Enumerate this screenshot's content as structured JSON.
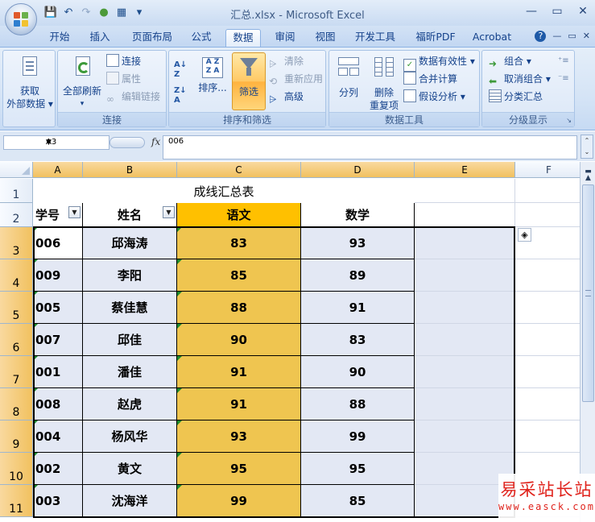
{
  "window": {
    "title": "汇总.xlsx - Microsoft Excel",
    "controls": [
      "—",
      "▭",
      "✕"
    ]
  },
  "tabs": [
    "开始",
    "插入",
    "页面布局",
    "公式",
    "数据",
    "审阅",
    "视图",
    "开发工具",
    "福昕PDF",
    "Acrobat"
  ],
  "active_tab": "数据",
  "tab_right": [
    "?",
    "—",
    "▭",
    "✕"
  ],
  "ribbon": {
    "groups": {
      "connections": "连接",
      "sort_filter": "排序和筛选",
      "data_tools": "数据工具",
      "outline": "分级显示"
    },
    "get_external_1": "获取",
    "get_external_2": "外部数据",
    "refresh_all": "全部刷新",
    "connections": "连接",
    "properties": "属性",
    "edit_links": "编辑链接",
    "sort": "排序...",
    "filter": "筛选",
    "clear": "清除",
    "reapply": "重新应用",
    "advanced": "高级",
    "text_to_columns": "分列",
    "remove_duplicates_1": "删除",
    "remove_duplicates_2": "重复项",
    "data_validation": "数据有效性",
    "consolidate": "合并计算",
    "what_if": "假设分析",
    "group": "组合",
    "ungroup": "取消组合",
    "subtotal": "分类汇总"
  },
  "formula_bar": {
    "name_box": "A3",
    "fx": "fx",
    "value": "006"
  },
  "sheet": {
    "columns": [
      "A",
      "B",
      "C",
      "D",
      "E",
      "F"
    ],
    "rows": [
      "1",
      "2",
      "3",
      "4",
      "5",
      "6",
      "7",
      "8",
      "9",
      "10",
      "11"
    ],
    "title": "成线汇总表",
    "headers": [
      "学号",
      "姓名",
      "语文",
      "数学"
    ],
    "data": [
      [
        "006",
        "邱海涛",
        "83",
        "93"
      ],
      [
        "009",
        "李阳",
        "85",
        "89"
      ],
      [
        "005",
        "蔡佳慧",
        "88",
        "91"
      ],
      [
        "007",
        "邱佳",
        "90",
        "83"
      ],
      [
        "001",
        "潘佳",
        "91",
        "90"
      ],
      [
        "008",
        "赵虎",
        "91",
        "88"
      ],
      [
        "004",
        "杨风华",
        "93",
        "99"
      ],
      [
        "002",
        "黄文",
        "95",
        "95"
      ],
      [
        "003",
        "沈海洋",
        "99",
        "85"
      ]
    ]
  },
  "watermark": {
    "cn": "易采站长站",
    "url": "www.easck.com"
  },
  "colors": {
    "sorted_column": "#efc550",
    "header_highlight": "#ffc000",
    "selection": "#e3e8f4",
    "ribbon": "#d5e4f6"
  }
}
